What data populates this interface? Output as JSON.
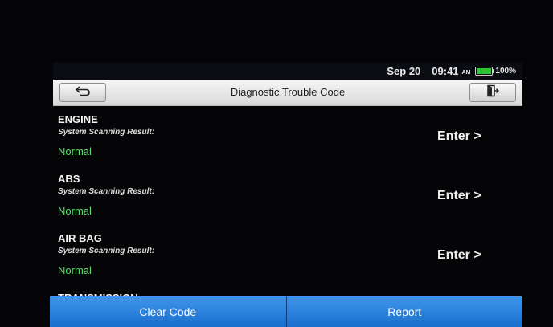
{
  "status_bar": {
    "date": "Sep 20",
    "time": "09:41",
    "ampm": "AM",
    "battery": "100%"
  },
  "header": {
    "title": "Diagnostic Trouble Code",
    "back_icon": "return-arrow-icon",
    "exit_icon": "exit-icon"
  },
  "systems": [
    {
      "name": "ENGINE",
      "subtitle": "System Scanning Result:",
      "result": "Normal",
      "action": "Enter >"
    },
    {
      "name": "ABS",
      "subtitle": "System Scanning Result:",
      "result": "Normal",
      "action": "Enter >"
    },
    {
      "name": "AIR BAG",
      "subtitle": "System Scanning Result:",
      "result": "Normal",
      "action": "Enter >"
    },
    {
      "name": "TRANSMISSION"
    }
  ],
  "footer": {
    "clear_label": "Clear Code",
    "report_label": "Report"
  },
  "colors": {
    "result_normal": "#57e16a",
    "button_blue": "#1e79d8",
    "battery_green": "#33c233"
  }
}
